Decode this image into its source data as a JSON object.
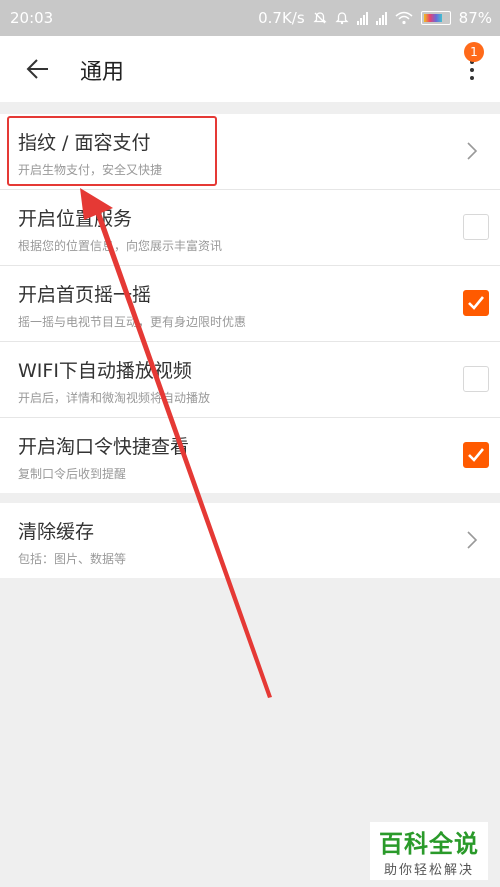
{
  "status_bar": {
    "time": "20:03",
    "net_speed": "0.7K/s",
    "battery_percent": "87%"
  },
  "header": {
    "title": "通用",
    "badge_count": "1"
  },
  "settings": [
    {
      "title": "指纹 / 面容支付",
      "subtitle": "开启生物支付，安全又快捷",
      "control": "chevron"
    },
    {
      "title": "开启位置服务",
      "subtitle": "根据您的位置信息，向您展示丰富资讯",
      "control": "checkbox",
      "checked": false
    },
    {
      "title": "开启首页摇一摇",
      "subtitle": "摇一摇与电视节目互动，更有身边限时优惠",
      "control": "checkbox",
      "checked": true
    },
    {
      "title": "WIFI下自动播放视频",
      "subtitle": "开启后，详情和微淘视频将自动播放",
      "control": "checkbox",
      "checked": false
    },
    {
      "title": "开启淘口令快捷查看",
      "subtitle": "复制口令后收到提醒",
      "control": "checkbox",
      "checked": true
    }
  ],
  "cache": {
    "title": "清除缓存",
    "subtitle": "包括：图片、数据等"
  },
  "watermark": {
    "title": "百科全说",
    "subtitle": "助你轻松解决"
  },
  "colors": {
    "accent": "#ff5a00",
    "annotation": "#e53935",
    "badge": "#ff6a1a"
  },
  "icons": [
    "back-arrow-icon",
    "more-vertical-icon",
    "chevron-right-icon",
    "checkmark-icon",
    "mute-icon",
    "alarm-icon",
    "signal-icon",
    "wifi-icon",
    "battery-icon"
  ]
}
